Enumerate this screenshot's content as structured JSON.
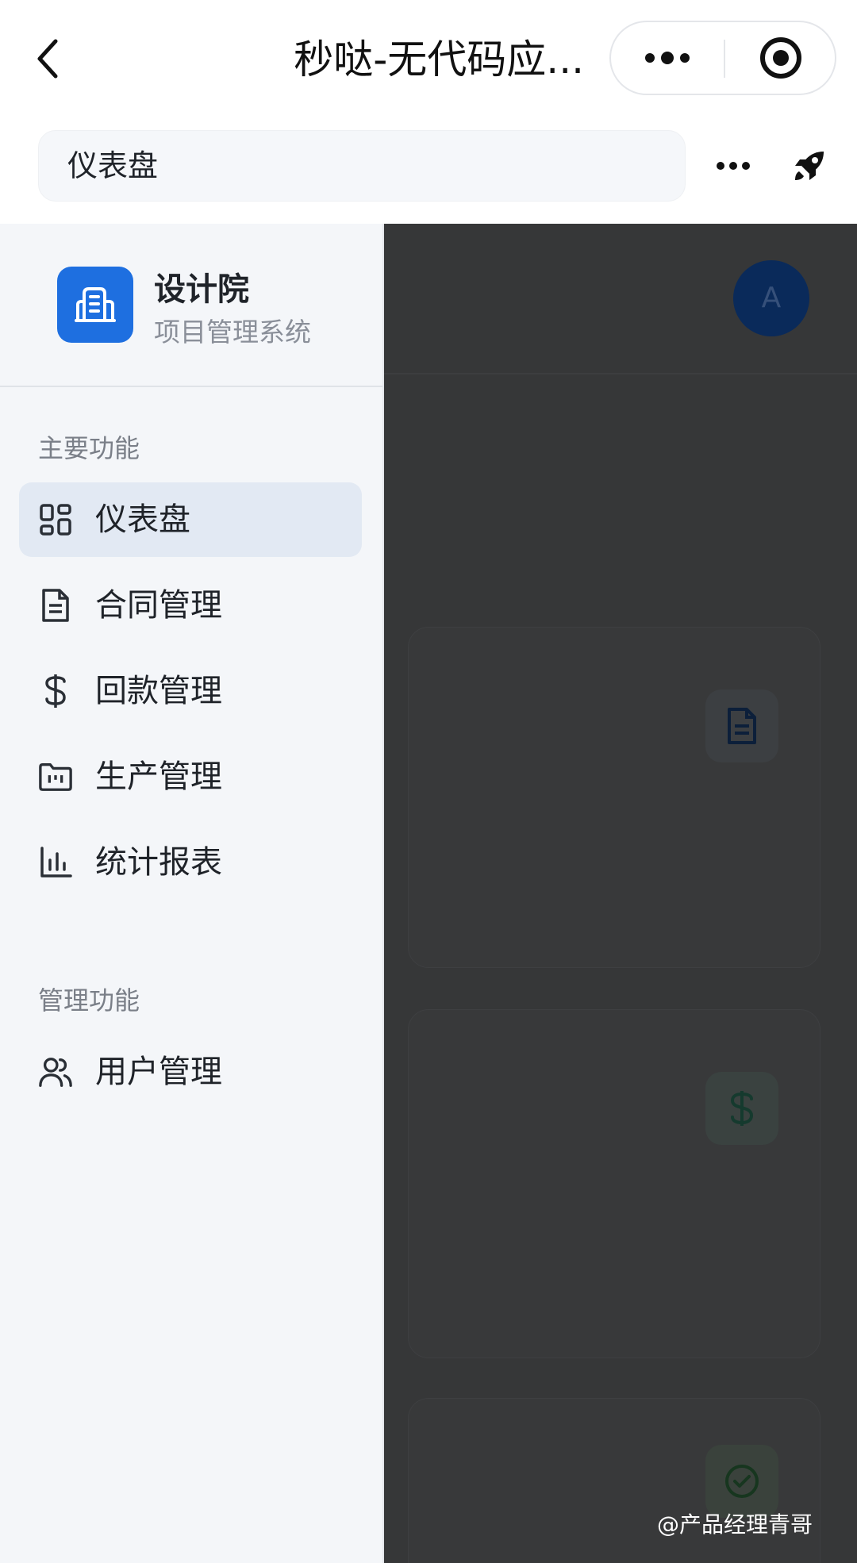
{
  "topbar": {
    "app_title": "秒哒-无代码应...",
    "back_icon": "chevron-left-icon",
    "more_icon": "ellipsis-icon",
    "close_icon": "target-circle-icon"
  },
  "page_header": {
    "title": "仪表盘",
    "more_icon": "ellipsis-icon",
    "action_icon": "rocket-icon"
  },
  "sidebar": {
    "brand": {
      "logo_icon": "building-icon",
      "name": "设计院",
      "subtitle": "项目管理系统",
      "logo_color": "#1e6fe0"
    },
    "sections": [
      {
        "label": "主要功能",
        "items": [
          {
            "label": "仪表盘",
            "icon": "dashboard-grid-icon",
            "active": true
          },
          {
            "label": "合同管理",
            "icon": "document-icon",
            "active": false
          },
          {
            "label": "回款管理",
            "icon": "dollar-icon",
            "active": false
          },
          {
            "label": "生产管理",
            "icon": "folder-kanban-icon",
            "active": false
          },
          {
            "label": "统计报表",
            "icon": "bar-chart-icon",
            "active": false
          }
        ]
      },
      {
        "label": "管理功能",
        "items": [
          {
            "label": "用户管理",
            "icon": "users-icon",
            "active": false
          }
        ]
      }
    ]
  },
  "overlay": {
    "avatar_letter": "A",
    "card_icons": [
      "document-icon",
      "dollar-icon",
      "check-circle-icon"
    ]
  },
  "watermark": "@产品经理青哥",
  "colors": {
    "accent": "#1e6fe0",
    "active_item_bg": "#e2e9f3",
    "overlay": "#363738"
  }
}
